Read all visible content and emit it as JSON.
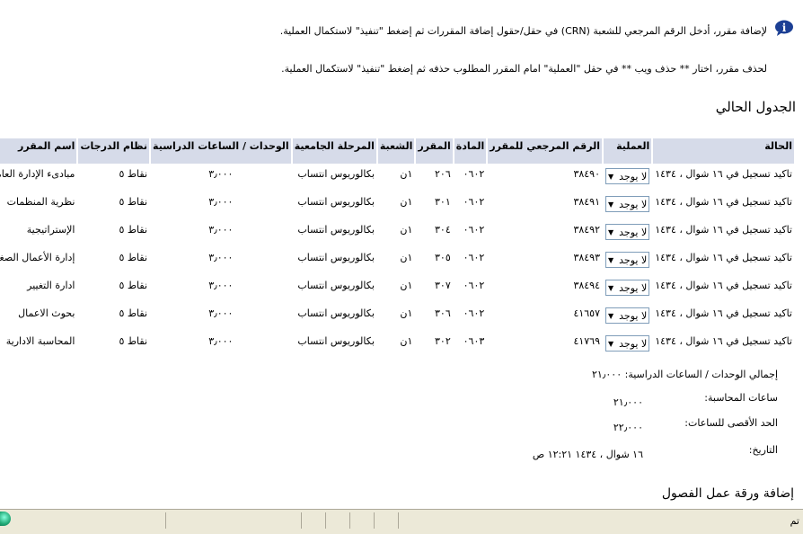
{
  "instructions": {
    "add_text": "لإضافة مقرر، أدخل الرقم المرجعي للشعبة (CRN) في حقل/حقول إضافة المقررات ثم إضغط \"تنفيذ\" لاستكمال العملية.",
    "drop_text": "لحذف مقرر، اختار ** حذف ويب ** في حقل \"العملية\" امام المقرر المطلوب حذفه ثم إضغط \"تنفيذ\" لاستكمال العملية."
  },
  "current_schedule": {
    "title": "الجدول الحالي",
    "columns": [
      "الحالة",
      "العملية",
      "الرقم المرجعي للمقرر",
      "المادة",
      "المقرر",
      "الشعبة",
      "المرحلة الجامعية",
      "الوحدات / الساعات الدراسية",
      "نظام الدرجات",
      "اسم المقرر"
    ],
    "rows": [
      {
        "status": "تاكيد تسجيل في ١٦ شوال ، ١٤٣٤",
        "action": "لا يوجد",
        "crn": "٣٨٤٩٠",
        "subject": "٠٦٠٢",
        "course": "٢٠٦",
        "section": "١ن",
        "level": "بكالوريوس انتساب",
        "credits": "٣٫٠٠٠",
        "grade_mode": "نقاط ٥",
        "title": "مبادىء الإدارة العامة"
      },
      {
        "status": "تاكيد تسجيل في ١٦ شوال ، ١٤٣٤",
        "action": "لا يوجد",
        "crn": "٣٨٤٩١",
        "subject": "٠٦٠٢",
        "course": "٣٠١",
        "section": "١ن",
        "level": "بكالوريوس انتساب",
        "credits": "٣٫٠٠٠",
        "grade_mode": "نقاط ٥",
        "title": "نظرية المنظمات"
      },
      {
        "status": "تاكيد تسجيل في ١٦ شوال ، ١٤٣٤",
        "action": "لا يوجد",
        "crn": "٣٨٤٩٢",
        "subject": "٠٦٠٢",
        "course": "٣٠٤",
        "section": "١ن",
        "level": "بكالوريوس انتساب",
        "credits": "٣٫٠٠٠",
        "grade_mode": "نقاط ٥",
        "title": "الإستراتيجية"
      },
      {
        "status": "تاكيد تسجيل في ١٦ شوال ، ١٤٣٤",
        "action": "لا يوجد",
        "crn": "٣٨٤٩٣",
        "subject": "٠٦٠٢",
        "course": "٣٠٥",
        "section": "١ن",
        "level": "بكالوريوس انتساب",
        "credits": "٣٫٠٠٠",
        "grade_mode": "نقاط ٥",
        "title": "إدارة الأعمال الصغيرة"
      },
      {
        "status": "تاكيد تسجيل في ١٦ شوال ، ١٤٣٤",
        "action": "لا يوجد",
        "crn": "٣٨٤٩٤",
        "subject": "٠٦٠٢",
        "course": "٣٠٧",
        "section": "١ن",
        "level": "بكالوريوس انتساب",
        "credits": "٣٫٠٠٠",
        "grade_mode": "نقاط ٥",
        "title": "ادارة التغيير"
      },
      {
        "status": "تاكيد تسجيل في ١٦ شوال ، ١٤٣٤",
        "action": "لا يوجد",
        "crn": "٤١٦٥٧",
        "subject": "٠٦٠٢",
        "course": "٣٠٦",
        "section": "١ن",
        "level": "بكالوريوس انتساب",
        "credits": "٣٫٠٠٠",
        "grade_mode": "نقاط ٥",
        "title": "بحوث الاعمال"
      },
      {
        "status": "تاكيد تسجيل في ١٦ شوال ، ١٤٣٤",
        "action": "لا يوجد",
        "crn": "٤١٧٦٩",
        "subject": "٠٦٠٣",
        "course": "٣٠٢",
        "section": "١ن",
        "level": "بكالوريوس انتساب",
        "credits": "٣٫٠٠٠",
        "grade_mode": "نقاط ٥",
        "title": "المحاسبة الادارية"
      }
    ]
  },
  "summary": {
    "total_label": "إجمالي الوحدات / الساعات الدراسية:",
    "total_value": "٢١٫٠٠٠",
    "billing_label": "ساعات المحاسبة:",
    "billing_value": "٢١٫٠٠٠",
    "max_label": "الحد الأقصى للساعات:",
    "max_value": "٢٢٫٠٠٠",
    "date_label": "التاريخ:",
    "date_value": "١٦ شوال ، ١٤٣٤ ١٢:٢١ ص"
  },
  "add_worksheet": {
    "title": "إضافة ورقة عمل الفصول"
  },
  "statusbar": {
    "text": "تم"
  },
  "icons": {
    "info": "info-icon",
    "globe": "internet-zone-icon"
  },
  "colors": {
    "header_bg": "#d6dbe9",
    "statusbar_bg": "#ece9d8"
  }
}
